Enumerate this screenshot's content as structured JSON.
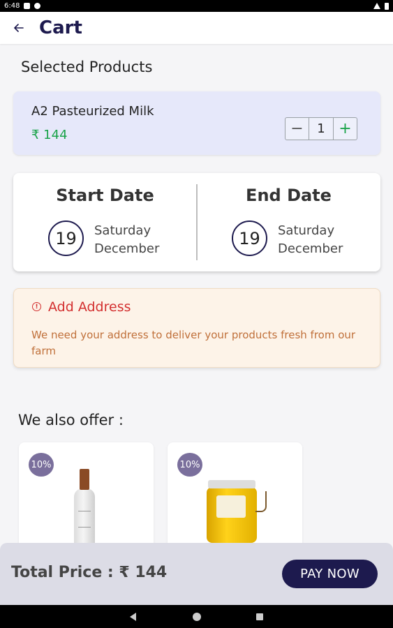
{
  "status_bar": {
    "time": "6:48"
  },
  "header": {
    "title": "Cart",
    "back_icon": "arrow-left-icon"
  },
  "selected_section": {
    "title": "Selected Products"
  },
  "products": [
    {
      "name": "A2 Pasteurized Milk",
      "price": "₹ 144",
      "quantity": "1",
      "minus_label": "−",
      "plus_label": "+"
    }
  ],
  "dates": {
    "start": {
      "label": "Start Date",
      "day": "19",
      "weekday": "Saturday",
      "month": "December"
    },
    "end": {
      "label": "End Date",
      "day": "19",
      "weekday": "Saturday",
      "month": "December"
    }
  },
  "address": {
    "icon": "info-icon",
    "icon_glyph": "!",
    "title": "Add Address",
    "description": "We need your address to deliver your products fresh from our farm"
  },
  "offers": {
    "title": "We also offer :",
    "items": [
      {
        "badge": "10%",
        "image": "milk-bottle-image"
      },
      {
        "badge": "10%",
        "image": "ghee-jar-image"
      }
    ]
  },
  "footer": {
    "total_label": "Total Price : ₹ 144",
    "pay_label": "PAY NOW"
  },
  "colors": {
    "primary": "#1d1a4e",
    "price_green": "#1aa34a",
    "alert_red": "#d32f2f",
    "product_card_bg": "#e6e8fa",
    "address_bg": "#fdf3e8"
  }
}
